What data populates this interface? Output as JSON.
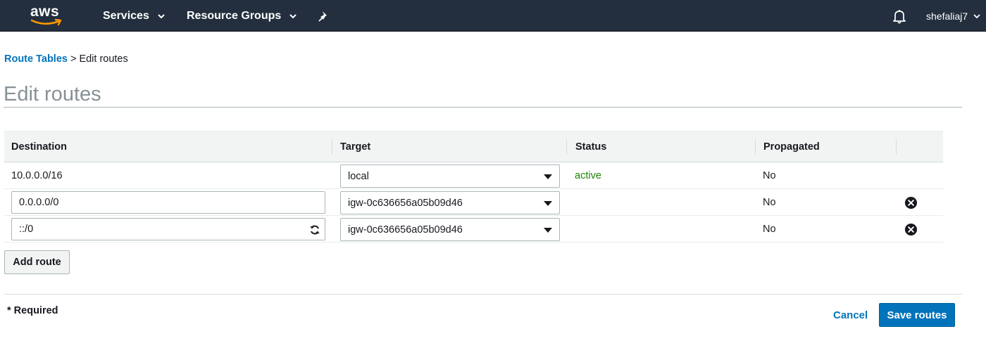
{
  "nav": {
    "logo_text": "aws",
    "services_label": "Services",
    "resource_groups_label": "Resource Groups",
    "username": "shefaliaj7"
  },
  "breadcrumb": {
    "parent": "Route Tables",
    "separator": ">",
    "current": "Edit routes"
  },
  "page_title": "Edit routes",
  "table": {
    "headers": {
      "destination": "Destination",
      "target": "Target",
      "status": "Status",
      "propagated": "Propagated"
    },
    "rows": [
      {
        "destination": "10.0.0.0/16",
        "target": "local",
        "status": "active",
        "propagated": "No"
      },
      {
        "destination": "0.0.0.0/0",
        "target": "igw-0c636656a05b09d46",
        "status": "",
        "propagated": "No"
      },
      {
        "destination": "::/0",
        "target": "igw-0c636656a05b09d46",
        "status": "",
        "propagated": "No"
      }
    ]
  },
  "actions": {
    "add_route_label": "Add route",
    "required_note": "* Required",
    "cancel_label": "Cancel",
    "save_label": "Save routes"
  },
  "colors": {
    "topbar": "#232f3e",
    "link": "#0073bb",
    "status_active": "#1d8102",
    "primary_button": "#0073bb"
  },
  "icons": [
    "aws-smile-icon",
    "chevron-down-icon",
    "pin-icon",
    "bell-icon",
    "refresh-icon",
    "remove-circle-icon"
  ]
}
